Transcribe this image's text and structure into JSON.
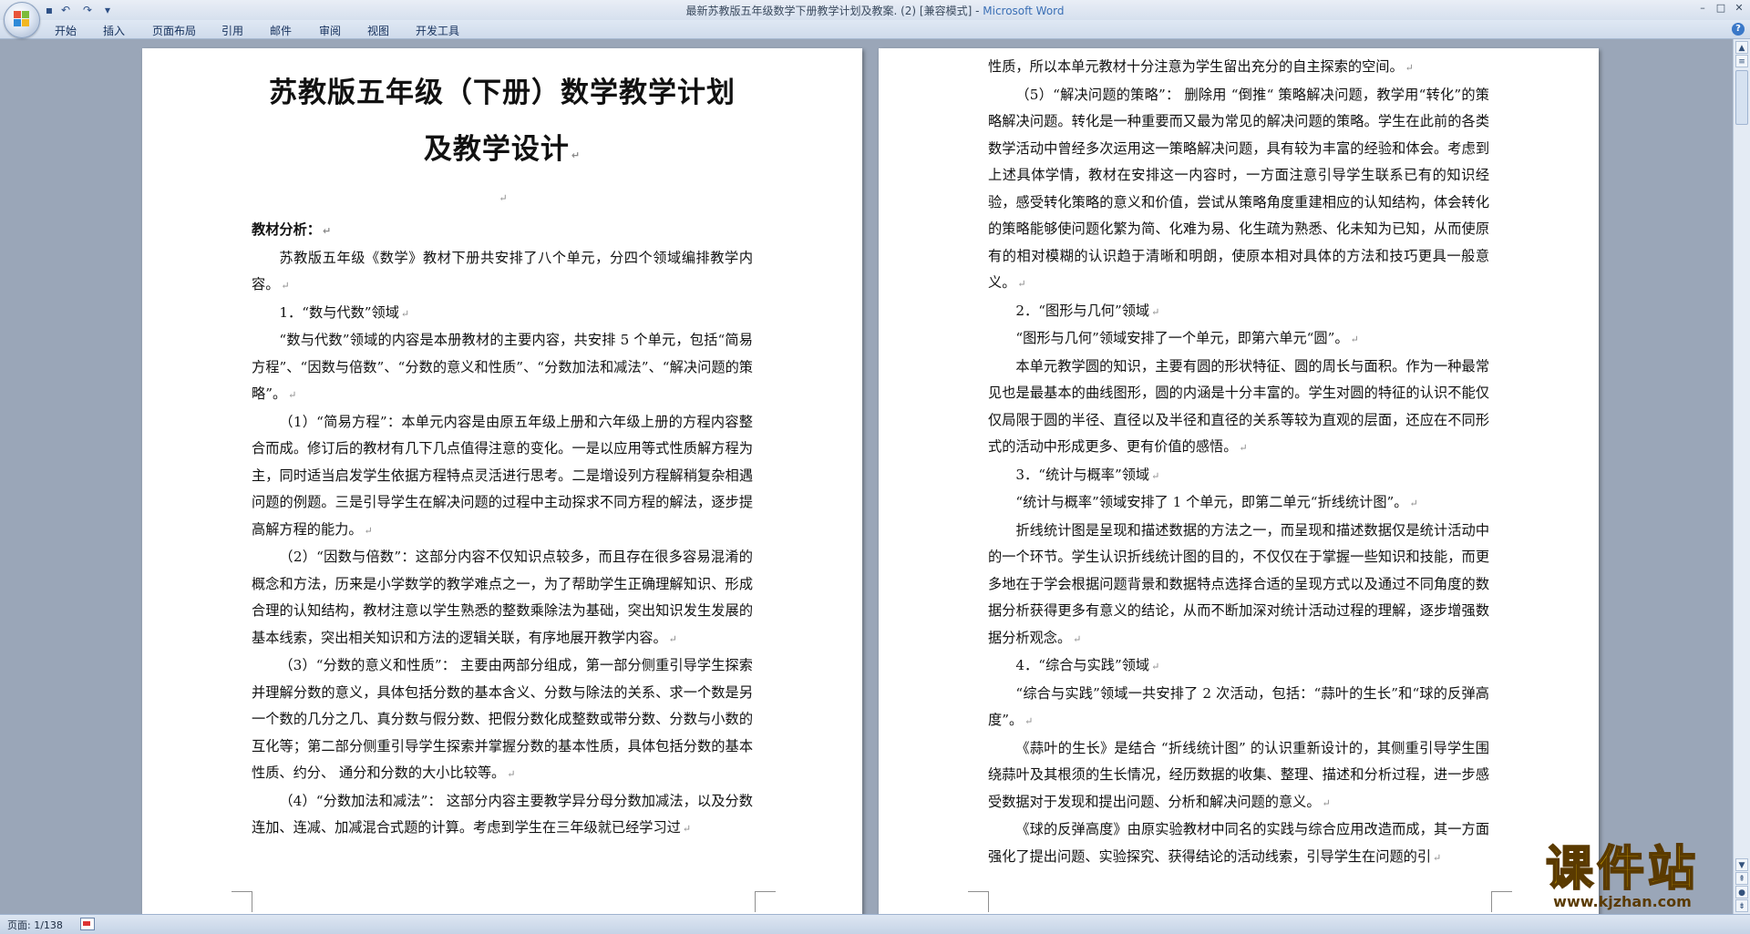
{
  "window": {
    "title_doc": "最新苏教版五年级数学下册教学计划及教案. (2) [兼容模式]",
    "title_sep": " - ",
    "title_app": "Microsoft Word"
  },
  "quick_access": [
    {
      "name": "save-icon",
      "glyph": "▪"
    },
    {
      "name": "undo-icon",
      "glyph": "↶"
    },
    {
      "name": "redo-icon",
      "glyph": "↷"
    },
    {
      "name": "customize-qat-icon",
      "glyph": "▾"
    }
  ],
  "ribbon": {
    "tabs": [
      "开始",
      "插入",
      "页面布局",
      "引用",
      "邮件",
      "审阅",
      "视图",
      "开发工具"
    ]
  },
  "document": {
    "title_line1": "苏教版五年级（下册）数学教学计划",
    "title_line2": "及教学设计",
    "left_page": [
      {
        "type": "empty"
      },
      {
        "type": "heading",
        "text": "教材分析："
      },
      {
        "type": "para",
        "text": "苏教版五年级《数学》教材下册共安排了八个单元，分四个领域编排教学内容。"
      },
      {
        "type": "para",
        "text": "1．“数与代数”领域"
      },
      {
        "type": "para",
        "text": "“数与代数”领域的内容是本册教材的主要内容，共安排 5 个单元，包括“简易方程”、“因数与倍数”、“分数的意义和性质”、“分数加法和减法”、“解决问题的策略”。"
      },
      {
        "type": "para",
        "text": "（1）“简易方程”：本单元内容是由原五年级上册和六年级上册的方程内容整合而成。修订后的教材有几下几点值得注意的变化。一是以应用等式性质解方程为主，同时适当启发学生依据方程特点灵活进行思考。二是增设列方程解稍复杂相遇问题的例题。三是引导学生在解决问题的过程中主动探求不同方程的解法，逐步提高解方程的能力。"
      },
      {
        "type": "para",
        "text": "（2）“因数与倍数”：这部分内容不仅知识点较多，而且存在很多容易混淆的概念和方法，历来是小学数学的教学难点之一，为了帮助学生正确理解知识、形成合理的认知结构，教材注意以学生熟悉的整数乘除法为基础，突出知识发生发展的基本线索，突出相关知识和方法的逻辑关联，有序地展开教学内容。"
      },
      {
        "type": "para",
        "text": "（3）“分数的意义和性质”： 主要由两部分组成，第一部分侧重引导学生探索并理解分数的意义，具体包括分数的基本含义、分数与除法的关系、求一个数是另一个数的几分之几、真分数与假分数、把假分数化成整数或带分数、分数与小数的互化等；第二部分侧重引导学生探索并掌握分数的基本性质，具体包括分数的基本性质、约分、 通分和分数的大小比较等。"
      },
      {
        "type": "para",
        "text": "（4）“分数加法和减法”： 这部分内容主要教学异分母分数加减法，以及分数连加、连减、加减混合式题的计算。考虑到学生在三年级就已经学习过"
      }
    ],
    "right_page": [
      {
        "type": "plain",
        "text": "性质，所以本单元教材十分注意为学生留出充分的自主探索的空间。"
      },
      {
        "type": "para",
        "text": "（5）“解决问题的策略”： 删除用 “倒推“ 策略解决问题，教学用“转化”的策略解决问题。转化是一种重要而又最为常见的解决问题的策略。学生在此前的各类数学活动中曾经多次运用这一策略解决问题，具有较为丰富的经验和体会。考虑到上述具体学情，教材在安排这一内容时，一方面注意引导学生联系已有的知识经验，感受转化策略的意义和价值，尝试从策略角度重建相应的认知结构，体会转化的策略能够使问题化繁为简、化难为易、化生疏为熟悉、化未知为已知，从而使原有的相对模糊的认识趋于清晰和明朗，使原本相对具体的方法和技巧更具一般意义。"
      },
      {
        "type": "para",
        "text": "2．“图形与几何”领域"
      },
      {
        "type": "para",
        "text": "“图形与几何”领域安排了一个单元，即第六单元“圆”。"
      },
      {
        "type": "para",
        "text": "本单元教学圆的知识，主要有圆的形状特征、圆的周长与面积。作为一种最常见也是最基本的曲线图形，圆的内涵是十分丰富的。学生对圆的特征的认识不能仅仅局限于圆的半径、直径以及半径和直径的关系等较为直观的层面，还应在不同形式的活动中形成更多、更有价值的感悟。"
      },
      {
        "type": "para",
        "text": "3．“统计与概率”领域"
      },
      {
        "type": "para",
        "text": "“统计与概率”领域安排了 1 个单元，即第二单元“折线统计图”。"
      },
      {
        "type": "para",
        "text": "折线统计图是呈现和描述数据的方法之一，而呈现和描述数据仅是统计活动中的一个环节。学生认识折线统计图的目的，不仅仅在于掌握一些知识和技能，而更多地在于学会根据问题背景和数据特点选择合适的呈现方式以及通过不同角度的数据分析获得更多有意义的结论，从而不断加深对统计活动过程的理解，逐步增强数据分析观念。"
      },
      {
        "type": "para",
        "text": "4．“综合与实践”领域"
      },
      {
        "type": "para",
        "text": "“综合与实践”领域一共安排了 2 次活动，包括：“蒜叶的生长”和“球的反弹高度”。"
      },
      {
        "type": "para",
        "text": "《蒜叶的生长》是结合 “折线统计图” 的认识重新设计的，其侧重引导学生围绕蒜叶及其根须的生长情况，经历数据的收集、整理、描述和分析过程，进一步感受数据对于发现和提出问题、分析和解决问题的意义。"
      },
      {
        "type": "para",
        "text": "《球的反弹高度》由原实验教材中同名的实践与综合应用改造而成，其一方面强化了提出问题、实验探究、获得结论的活动线索，引导学生在问题的引"
      }
    ]
  },
  "watermark": {
    "title": "课件站",
    "url": "www.kjzhan.com"
  },
  "status": {
    "page": "页面: 1/138"
  },
  "colors": {
    "accent": "#3a6fb5",
    "watermark_fill": "#f4c400"
  }
}
